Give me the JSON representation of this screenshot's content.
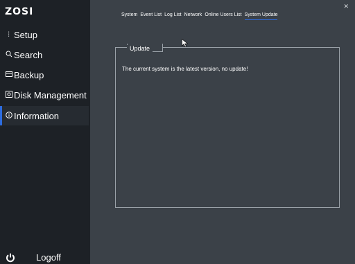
{
  "brand": {
    "logo_text": "ZOSI"
  },
  "sidebar": {
    "items": [
      {
        "label": "Setup",
        "icon": "sliders-icon"
      },
      {
        "label": "Search",
        "icon": "search-icon"
      },
      {
        "label": "Backup",
        "icon": "backup-icon"
      },
      {
        "label": "Disk Management",
        "icon": "disk-icon"
      },
      {
        "label": "Information",
        "icon": "info-icon",
        "active": true
      }
    ],
    "logoff_label": "Logoff"
  },
  "tabs": [
    {
      "label": "System"
    },
    {
      "label": "Event List"
    },
    {
      "label": "Log List"
    },
    {
      "label": "Network"
    },
    {
      "label": "Online Users List"
    },
    {
      "label": "System Update",
      "active": true
    }
  ],
  "panel": {
    "title": "Update",
    "message": "The current system is the latest version, no update!"
  },
  "colors": {
    "sidebar_bg": "#1d2126",
    "content_bg": "#3b4148",
    "accent": "#2d6cdf",
    "text": "#ffffff"
  }
}
